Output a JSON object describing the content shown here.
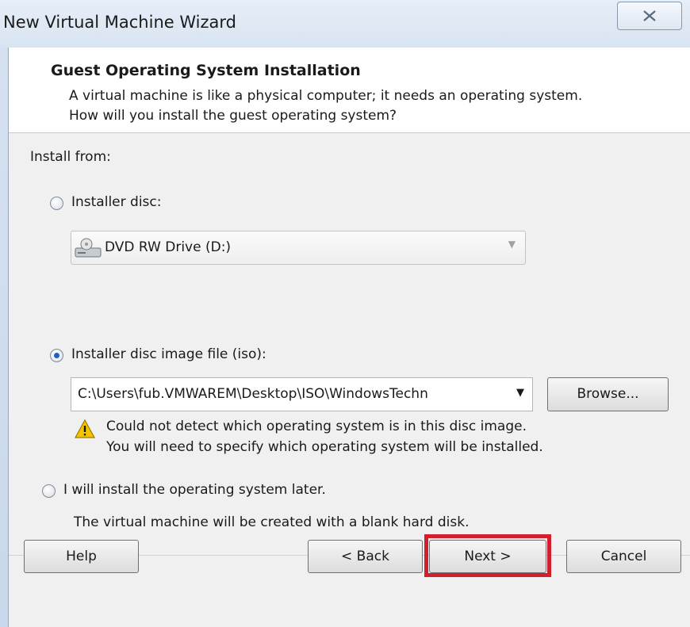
{
  "window": {
    "title": "New Virtual Machine Wizard"
  },
  "header": {
    "title": "Guest Operating System Installation",
    "description": "A virtual machine is like a physical computer; it needs an operating system. How will you install the guest operating system?"
  },
  "install_from_label": "Install from:",
  "options": {
    "installer_disc": {
      "label": "Installer disc:",
      "selected": false,
      "drive_value": "DVD RW Drive (D:)"
    },
    "iso": {
      "label": "Installer disc image file (iso):",
      "selected": true,
      "path_value": "C:\\Users\\fub.VMWAREM\\Desktop\\ISO\\WindowsTechn",
      "browse_label": "Browse..."
    },
    "later": {
      "label": "I will install the operating system later.",
      "selected": false,
      "note": "The virtual machine will be created with a blank hard disk."
    }
  },
  "warning": {
    "line1": "Could not detect which operating system is in this disc image.",
    "line2": "You will need to specify which operating system will be installed."
  },
  "buttons": {
    "help": "Help",
    "back": "< Back",
    "next": "Next >",
    "cancel": "Cancel"
  },
  "colors": {
    "highlight": "#d01f2d",
    "radio_selected": "#1f5fc0",
    "warning": "#f5c400"
  }
}
